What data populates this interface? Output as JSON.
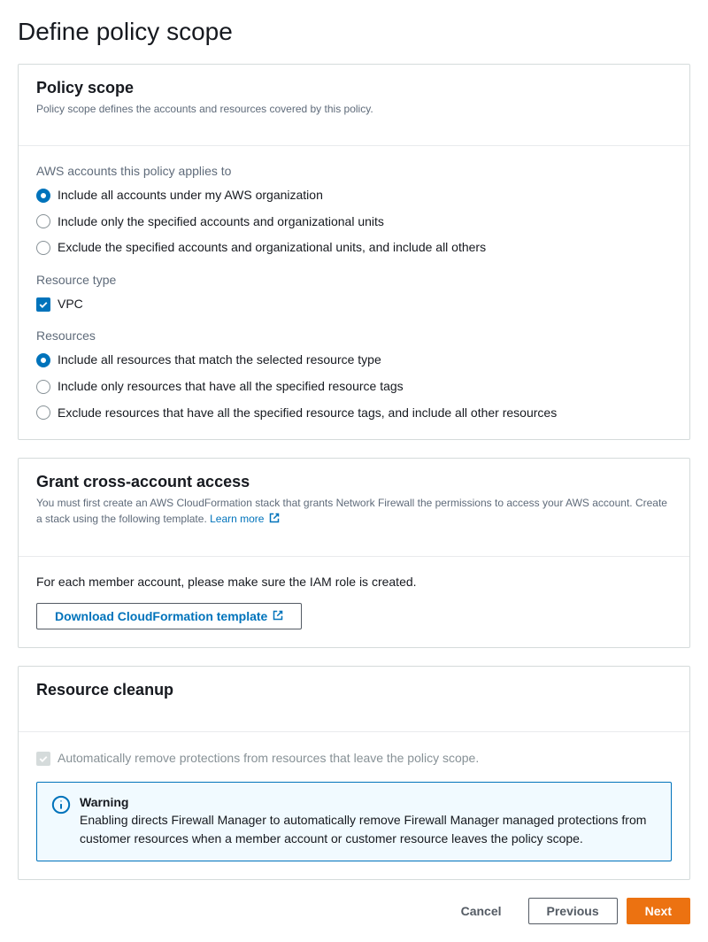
{
  "page_title": "Define policy scope",
  "policy_scope_panel": {
    "title": "Policy scope",
    "subtitle": "Policy scope defines the accounts and resources covered by this policy.",
    "accounts_section": {
      "label": "AWS accounts this policy applies to",
      "options": [
        {
          "label": "Include all accounts under my AWS organization",
          "selected": true
        },
        {
          "label": "Include only the specified accounts and organizational units",
          "selected": false
        },
        {
          "label": "Exclude the specified accounts and organizational units, and include all others",
          "selected": false
        }
      ]
    },
    "resource_type_section": {
      "label": "Resource type",
      "options": [
        {
          "label": "VPC",
          "checked": true
        }
      ]
    },
    "resources_section": {
      "label": "Resources",
      "options": [
        {
          "label": "Include all resources that match the selected resource type",
          "selected": true
        },
        {
          "label": "Include only resources that have all the specified resource tags",
          "selected": false
        },
        {
          "label": "Exclude resources that have all the specified resource tags, and include all other resources",
          "selected": false
        }
      ]
    }
  },
  "cross_account_panel": {
    "title": "Grant cross-account access",
    "subtitle_part1": "You must first create an AWS CloudFormation stack that grants Network Firewall the permissions to access your AWS account. Create a stack using the following template. ",
    "learn_more": "Learn more",
    "info_text": "For each member account, please make sure the IAM role is created.",
    "download_button": "Download CloudFormation template"
  },
  "cleanup_panel": {
    "title": "Resource cleanup",
    "checkbox_label": "Automatically remove protections from resources that leave the policy scope.",
    "warning": {
      "title": "Warning",
      "text": "Enabling directs Firewall Manager to automatically remove Firewall Manager managed protections from customer resources when a member account or customer resource leaves the policy scope."
    }
  },
  "footer": {
    "cancel": "Cancel",
    "previous": "Previous",
    "next": "Next"
  }
}
